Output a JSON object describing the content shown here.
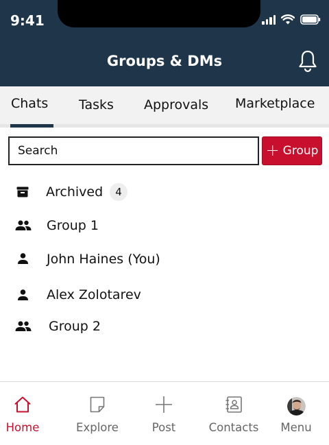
{
  "status_bar": {
    "time": "9:41"
  },
  "header": {
    "title": "Groups & DMs",
    "bell_icon": "bell-icon"
  },
  "tabs": [
    {
      "label": "Chats",
      "active": true
    },
    {
      "label": "Tasks",
      "active": false
    },
    {
      "label": "Approvals",
      "active": false
    },
    {
      "label": "Marketplace",
      "active": false
    }
  ],
  "search": {
    "placeholder": "Search"
  },
  "group_button": {
    "plus": "+",
    "label": "Group"
  },
  "list": [
    {
      "label": "Archived",
      "icon": "archive-icon",
      "badge": "4"
    },
    {
      "label": "Group 1",
      "icon": "group-icon"
    },
    {
      "label": "John Haines (You)",
      "icon": "person-icon"
    },
    {
      "label": "Alex Zolotarev",
      "icon": "person-icon"
    },
    {
      "label": "Group 2",
      "icon": "group-icon"
    }
  ],
  "bottom_nav": [
    {
      "label": "Home",
      "icon": "home-icon",
      "active": true
    },
    {
      "label": "Explore",
      "icon": "note-icon",
      "active": false
    },
    {
      "label": "Post",
      "icon": "plus-icon",
      "active": false
    },
    {
      "label": "Contacts",
      "icon": "contacts-icon",
      "active": false
    },
    {
      "label": "Menu",
      "icon": "avatar",
      "active": false
    }
  ],
  "colors": {
    "header_bg": "#1e354a",
    "accent": "#c8102e",
    "tabs_bg": "#f2f2f2",
    "nav_inactive": "#666666"
  }
}
